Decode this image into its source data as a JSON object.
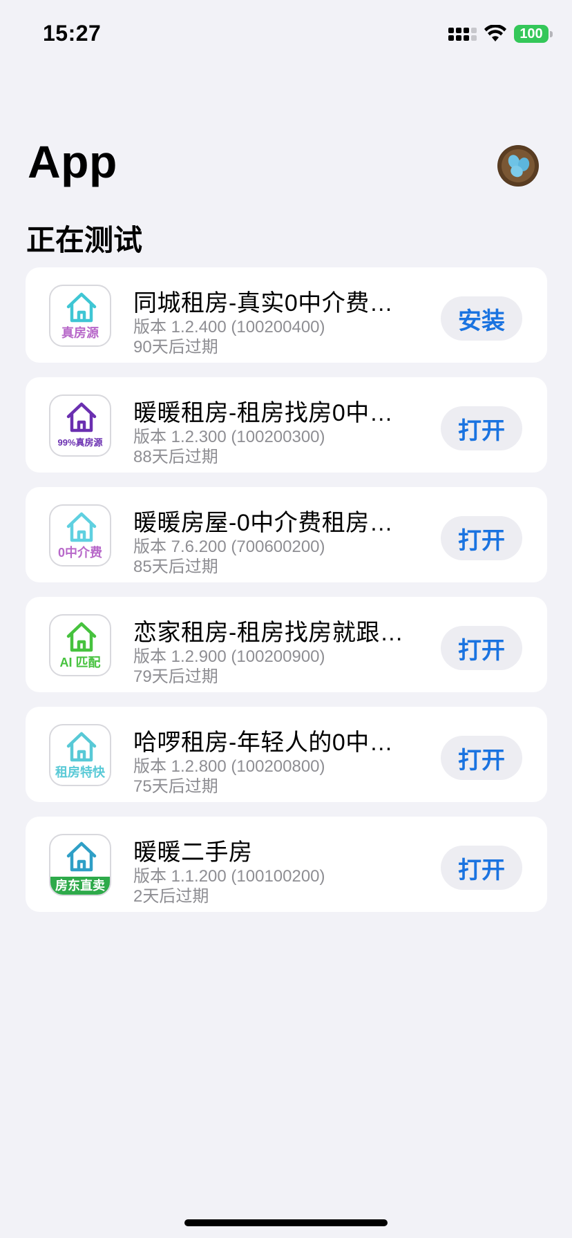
{
  "status_bar": {
    "time": "15:27",
    "battery": "100"
  },
  "header": {
    "title": "App",
    "section": "正在测试"
  },
  "apps": [
    {
      "name": "同城租房-真实0中介费…",
      "version": "版本 1.2.400 (100200400)",
      "expiry": "90天后过期",
      "action": "安装",
      "icon": {
        "name": "house-icon",
        "tag": "真房源",
        "color": "#3fc6d4",
        "tag_color": "#b768c9",
        "style": "normal"
      }
    },
    {
      "name": "暖暖租房-租房找房0中…",
      "version": "版本 1.2.300 (100200300)",
      "expiry": "88天后过期",
      "action": "打开",
      "icon": {
        "name": "house-icon",
        "tag": "99%真房源",
        "color": "#6a2fb0",
        "tag_color": "#6a2fb0",
        "style": "small"
      }
    },
    {
      "name": "暖暖房屋-0中介费租房…",
      "version": "版本 7.6.200 (700600200)",
      "expiry": "85天后过期",
      "action": "打开",
      "icon": {
        "name": "house-icon",
        "tag": "0中介费",
        "color": "#5fd0e0",
        "tag_color": "#b768c9",
        "style": "normal"
      }
    },
    {
      "name": "恋家租房-租房找房就跟…",
      "version": "版本 1.2.900 (100200900)",
      "expiry": "79天后过期",
      "action": "打开",
      "icon": {
        "name": "house-icon",
        "tag": "AI 匹配",
        "color": "#46c23e",
        "tag_color": "#46c23e",
        "style": "normal"
      }
    },
    {
      "name": "哈啰租房-年轻人的0中…",
      "version": "版本 1.2.800 (100200800)",
      "expiry": "75天后过期",
      "action": "打开",
      "icon": {
        "name": "house-icon",
        "tag": "租房特快",
        "color": "#58c9d6",
        "tag_color": "#58c9d6",
        "style": "normal"
      }
    },
    {
      "name": "暖暖二手房",
      "version": "版本 1.1.200 (100100200)",
      "expiry": "2天后过期",
      "action": "打开",
      "icon": {
        "name": "house-icon",
        "tag": "房东直卖",
        "color": "#2f9fc6",
        "tag_color": "#ffffff",
        "style": "banner"
      }
    }
  ],
  "colors": {
    "accent": "#1a73e0",
    "background": "#f2f2f7",
    "battery": "#34c759"
  }
}
